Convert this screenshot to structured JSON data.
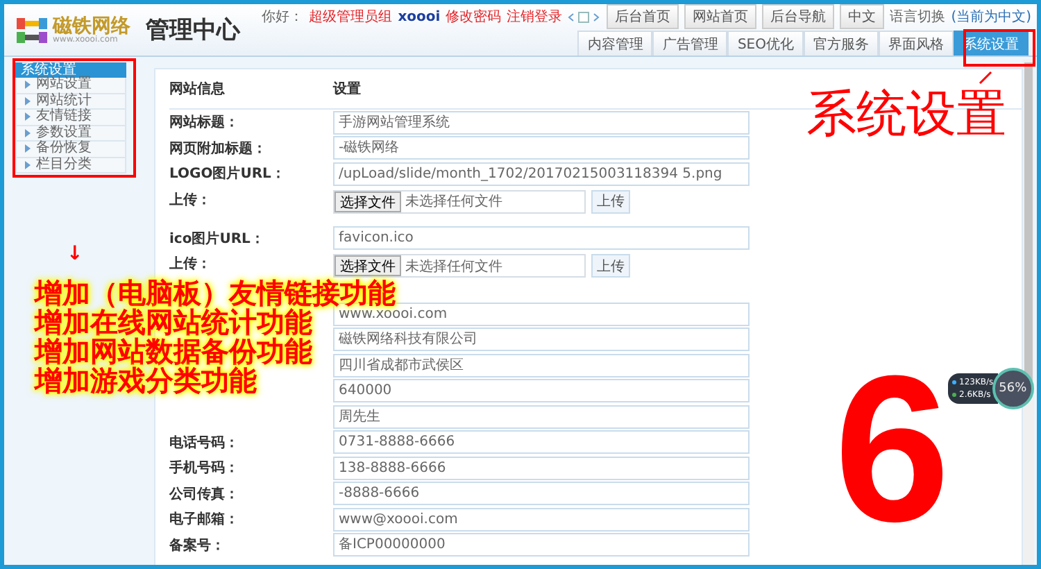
{
  "header": {
    "logo": {
      "name": "磁铁网络",
      "url": "www.xoooi.com"
    },
    "title": "管理中心",
    "greeting": "你好：",
    "role": "超级管理员组",
    "user": "xoooi",
    "links": [
      "修改密码",
      "注销登录"
    ],
    "buttons": [
      "后台首页",
      "网站首页",
      "后台导航",
      "中文"
    ],
    "language_label": "语言切换",
    "language_current": "(当前为中文)"
  },
  "tabs": [
    {
      "label": "内容管理",
      "selected": false
    },
    {
      "label": "广告管理",
      "selected": false
    },
    {
      "label": "SEO优化",
      "selected": false
    },
    {
      "label": "官方服务",
      "selected": false
    },
    {
      "label": "界面风格",
      "selected": false
    },
    {
      "label": "系统设置",
      "selected": true
    }
  ],
  "sidebar": {
    "title": "系统设置",
    "items": [
      "网站设置",
      "网站统计",
      "友情链接",
      "参数设置",
      "备份恢复",
      "栏目分类"
    ]
  },
  "form": {
    "columns": [
      "网站信息",
      "设置"
    ],
    "rows": [
      {
        "kind": "text",
        "label": "网站标题：",
        "value": "手游网站管理系统"
      },
      {
        "kind": "text",
        "label": "网页附加标题：",
        "value": "-磁铁网络"
      },
      {
        "kind": "text",
        "label": "LOGO图片URL：",
        "value": "/upLoad/slide/month_1702/20170215003118394 5.png"
      },
      {
        "kind": "upload",
        "label": "上传：",
        "button": "选择文件",
        "file_text": "未选择任何文件",
        "submit": "上传"
      },
      {
        "kind": "text",
        "label": "ico图片URL：",
        "value": "favicon.ico"
      },
      {
        "kind": "upload",
        "label": "上传：",
        "button": "选择文件",
        "file_text": "未选择任何文件",
        "submit": "上传"
      },
      {
        "kind": "text",
        "value": "www.xoooi.com"
      },
      {
        "kind": "text",
        "value": "磁铁网络科技有限公司"
      },
      {
        "kind": "text",
        "value": "四川省成都市武侯区"
      },
      {
        "kind": "text",
        "value": "640000"
      },
      {
        "kind": "text",
        "value": "周先生"
      },
      {
        "kind": "text",
        "label": "电话号码：",
        "value": "0731-8888-6666"
      },
      {
        "kind": "text",
        "label": "手机号码：",
        "value": "138-8888-6666"
      },
      {
        "kind": "text",
        "label": "公司传真：",
        "value": "-8888-6666"
      },
      {
        "kind": "text",
        "label": "电子邮箱：",
        "value": "www@xoooi.com"
      },
      {
        "kind": "text",
        "label": "备案号：",
        "value": "备ICP00000000"
      }
    ]
  },
  "annotations": {
    "arrow": "↓",
    "notes": [
      "增加（电脑板）友情链接功能",
      "增加在线网站统计功能",
      "增加网站数据备份功能",
      "增加游戏分类功能"
    ],
    "callout": "系统设置",
    "number": "6"
  },
  "net_widget": {
    "upload": "123KB/s",
    "download": "2.6KB/s",
    "percent": "56%"
  }
}
